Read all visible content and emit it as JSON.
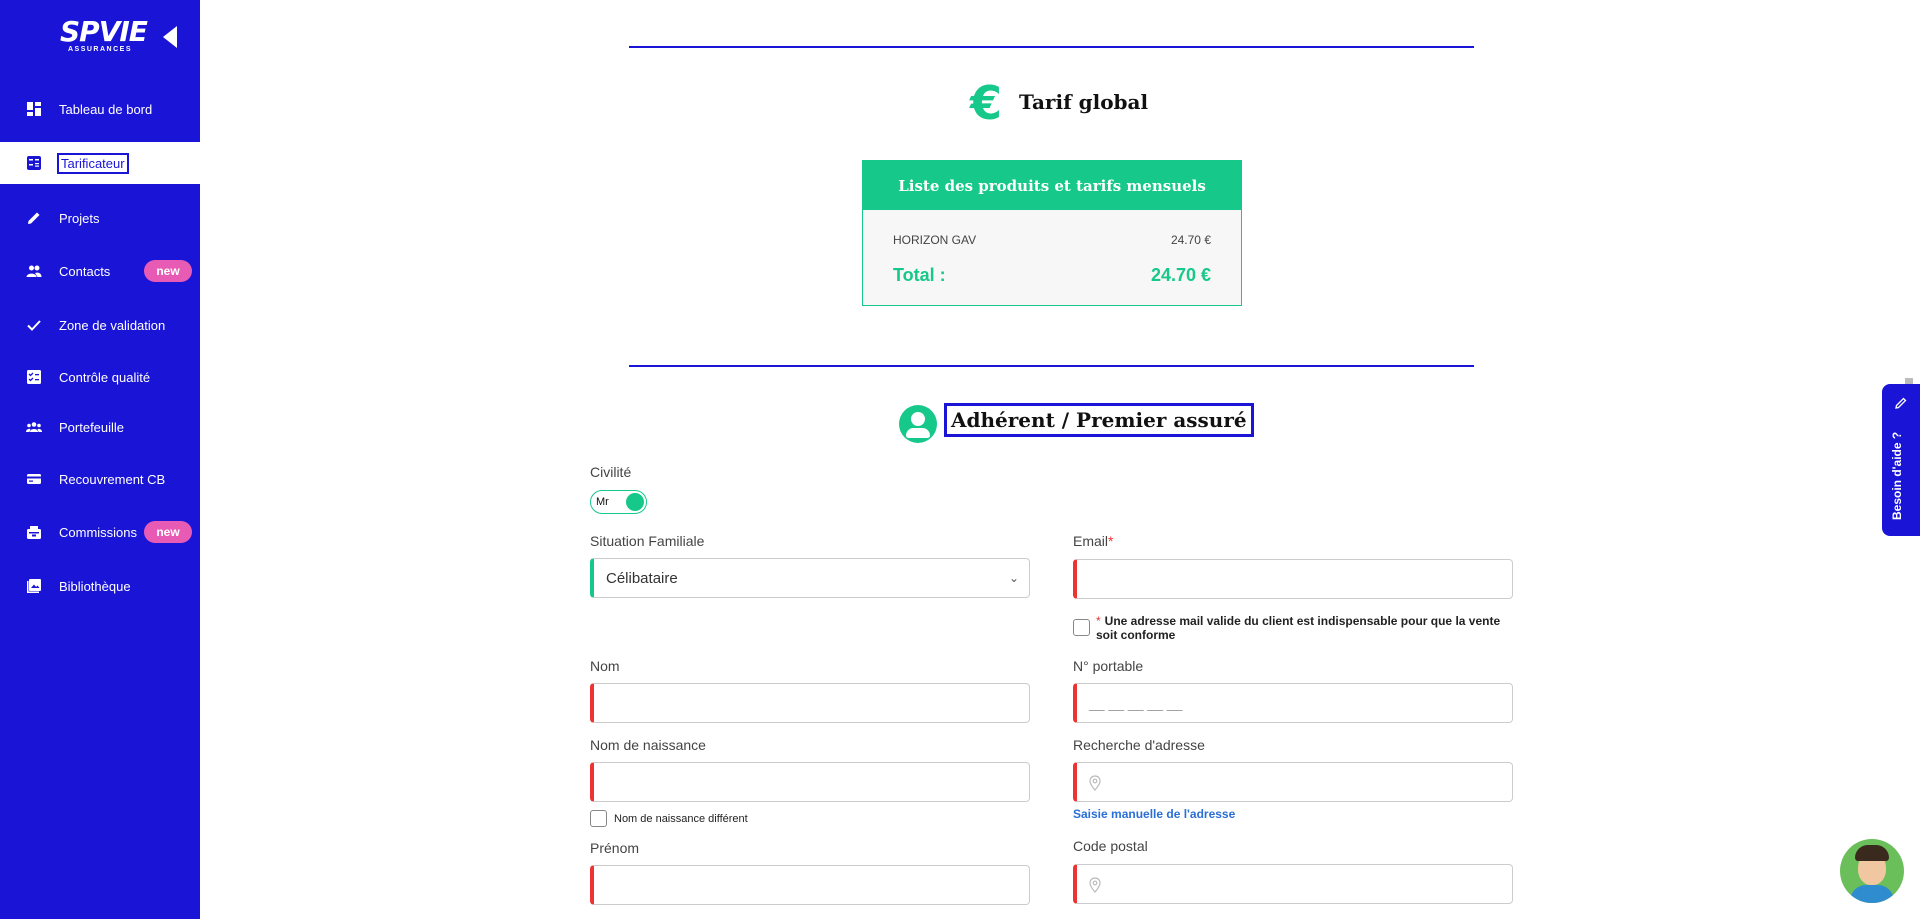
{
  "logo": {
    "big": "SPVIE",
    "small": "ASSURANCES"
  },
  "sidebar": {
    "items": [
      {
        "label": "Tableau de bord",
        "icon": "dashboard-icon"
      },
      {
        "label": "Tarificateur",
        "icon": "calculator-icon",
        "active": true
      },
      {
        "label": "Projets",
        "icon": "pencil-icon"
      },
      {
        "label": "Contacts",
        "icon": "people-icon",
        "badge": "new"
      },
      {
        "label": "Zone de validation",
        "icon": "check-icon"
      },
      {
        "label": "Contrôle qualité",
        "icon": "checklist-icon"
      },
      {
        "label": "Portefeuille",
        "icon": "group-icon"
      },
      {
        "label": "Recouvrement CB",
        "icon": "credit-card-icon"
      },
      {
        "label": "Commissions",
        "icon": "commission-icon",
        "badge": "new"
      },
      {
        "label": "Bibliothèque",
        "icon": "library-icon"
      }
    ]
  },
  "tarif": {
    "title": "Tarif global",
    "card_title": "Liste des produits et tarifs mensuels",
    "product_name": "HORIZON GAV",
    "product_price": "24.70 €",
    "total_label": "Total :",
    "total_value": "24.70 €"
  },
  "adherent": {
    "title": "Adhérent / Premier assuré",
    "civilite_label": "Civilité",
    "civilite_value": "Mr",
    "situation_label": "Situation Familiale",
    "situation_value": "Célibataire",
    "email_label": "Email",
    "email_required": "*",
    "email_note_star": "*",
    "email_note": "Une adresse mail valide du client est indispensable pour que la vente soit conforme",
    "nom_label": "Nom",
    "portable_label": "N° portable",
    "portable_placeholder": "__ __ __ __ __",
    "naissance_label": "Nom de naissance",
    "naissance_diff_label": "Nom de naissance différent",
    "adresse_label": "Recherche d'adresse",
    "adresse_manual_link": "Saisie manuelle de l'adresse",
    "prenom_label": "Prénom",
    "cp_label": "Code postal"
  },
  "help": {
    "label": "Besoin d'aide ?"
  },
  "colors": {
    "brand": "#1a14d6",
    "accent": "#16c98a",
    "required": "#e33333",
    "badge": "#e85bb4"
  }
}
